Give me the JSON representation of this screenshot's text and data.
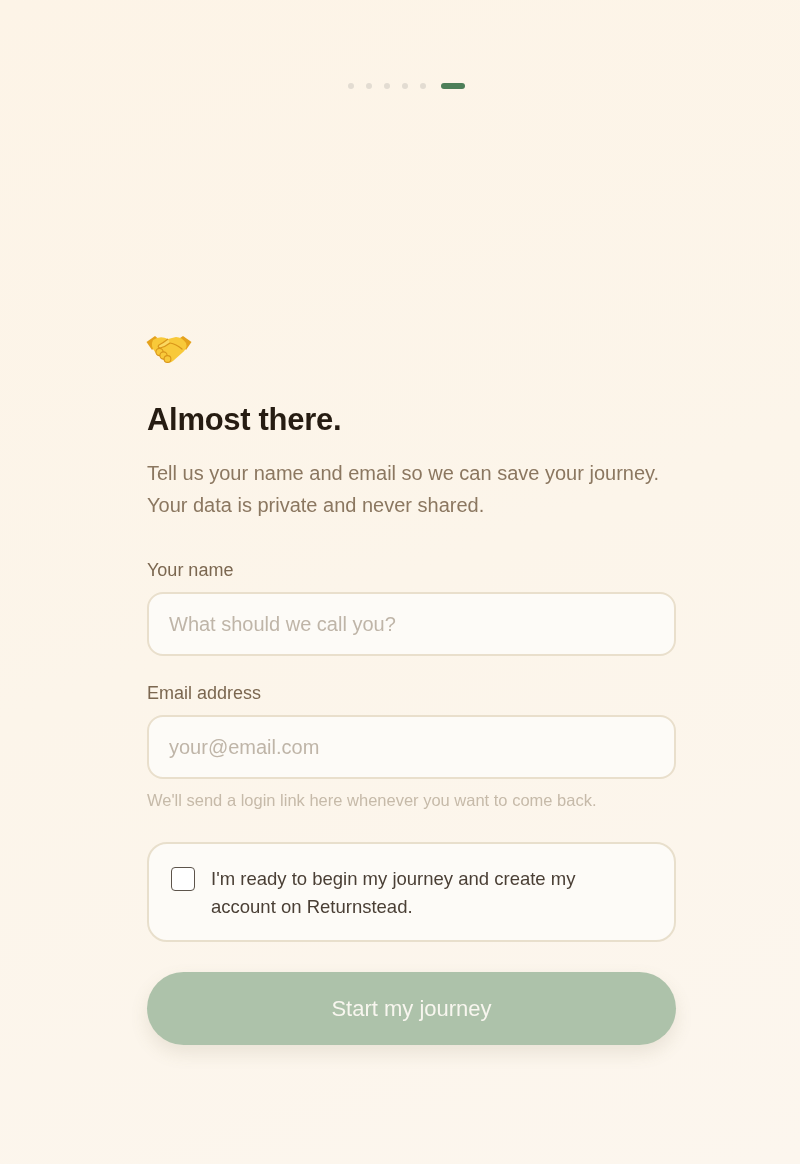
{
  "progress": {
    "steps": [
      {
        "selected": false
      },
      {
        "selected": false
      },
      {
        "selected": false
      },
      {
        "selected": false
      },
      {
        "selected": false
      },
      {
        "selected": true
      }
    ]
  },
  "heading": "Almost there.",
  "subtitle": "Tell us your name and email so we can save your journey. Your data is private and never shared.",
  "fields": [
    {
      "label": "Your name",
      "placeholder": "What should we call you?"
    },
    {
      "label": "Email address",
      "placeholder": "your@email.com",
      "hint": "We'll send a login link here whenever you want to come back."
    }
  ],
  "consent": {
    "checked": false,
    "text": "I'm ready to begin my journey and create my account on Returnstead."
  },
  "submit": {
    "label": "Start my journey",
    "disabled": true
  }
}
